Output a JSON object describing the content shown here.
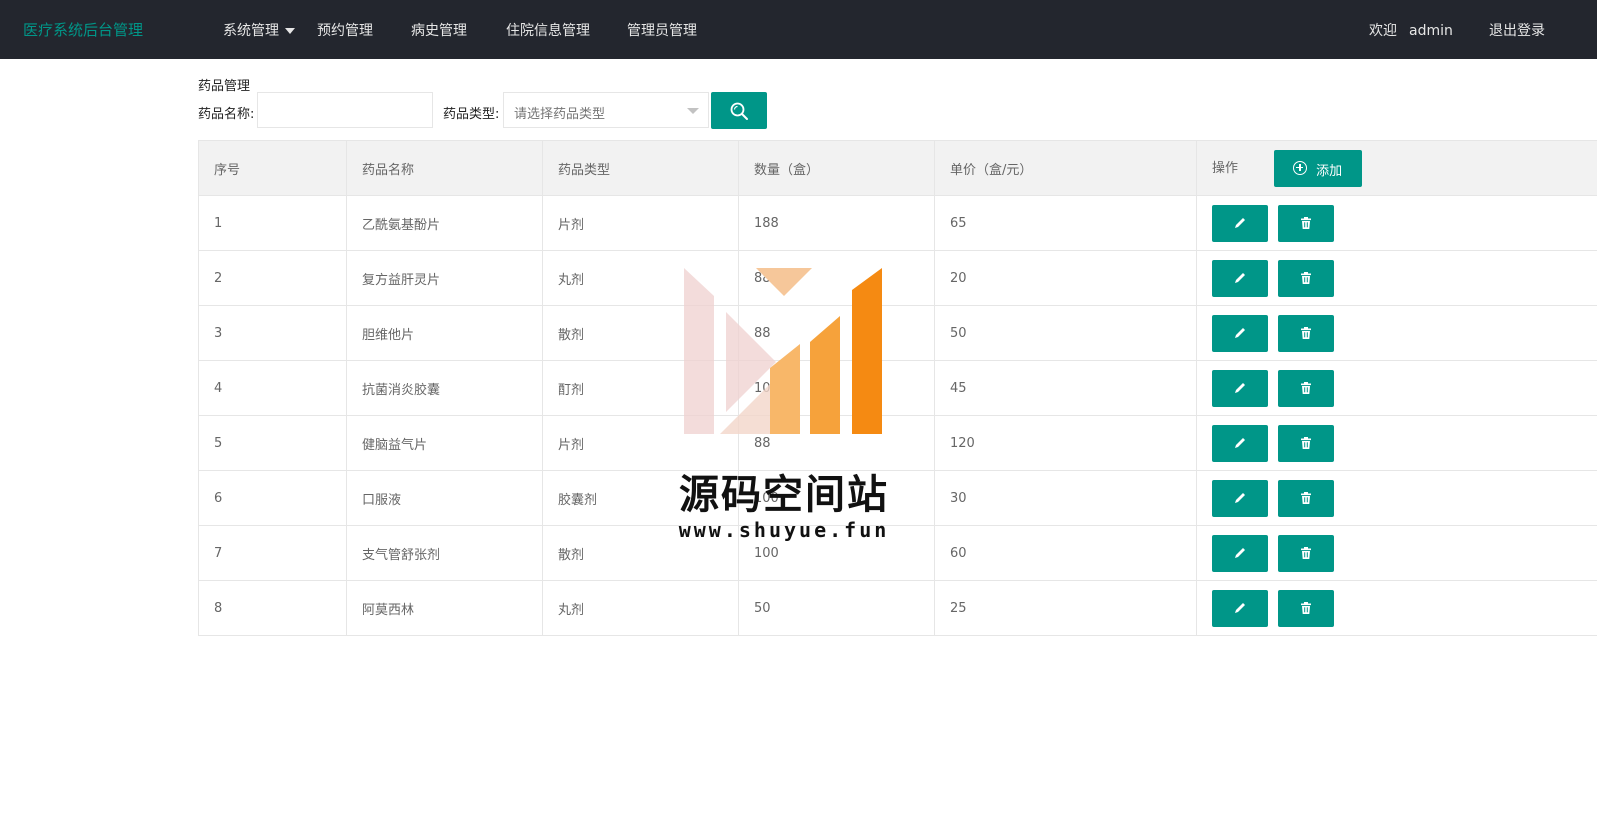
{
  "header": {
    "brand": "医疗系统后台管理",
    "nav": [
      {
        "label": "系统管理"
      },
      {
        "label": "预约管理"
      },
      {
        "label": "病史管理"
      },
      {
        "label": "住院信息管理"
      },
      {
        "label": "管理员管理"
      }
    ],
    "welcome_label": "欢迎",
    "username": "admin",
    "logout_label": "退出登录"
  },
  "search": {
    "section_title": "药品管理",
    "name_label": "药品名称:",
    "name_value": "",
    "type_label": "药品类型:",
    "type_placeholder": "请选择药品类型"
  },
  "table": {
    "headers": [
      "序号",
      "药品名称",
      "药品类型",
      "数量（盒）",
      "单价（盒/元）",
      "操作"
    ],
    "add_label": "添加",
    "rows": [
      {
        "id": "1",
        "name": "乙酰氨基酚片",
        "type": "片剂",
        "qty": "188",
        "price": "65"
      },
      {
        "id": "2",
        "name": "复方益肝灵片",
        "type": "丸剂",
        "qty": "88",
        "price": "20"
      },
      {
        "id": "3",
        "name": "胆维他片",
        "type": "散剂",
        "qty": "88",
        "price": "50"
      },
      {
        "id": "4",
        "name": "抗菌消炎胶囊",
        "type": "酊剂",
        "qty": "100",
        "price": "45"
      },
      {
        "id": "5",
        "name": "健脑益气片",
        "type": "片剂",
        "qty": "88",
        "price": "120"
      },
      {
        "id": "6",
        "name": "口服液",
        "type": "胶囊剂",
        "qty": "100",
        "price": "30"
      },
      {
        "id": "7",
        "name": "支气管舒张剂",
        "type": "散剂",
        "qty": "100",
        "price": "60"
      },
      {
        "id": "8",
        "name": "阿莫西林",
        "type": "丸剂",
        "qty": "50",
        "price": "25"
      }
    ]
  },
  "watermark": {
    "title": "源码空间站",
    "url": "www.shuyue.fun"
  },
  "colors": {
    "accent": "#009688",
    "topbar": "#23262e",
    "header_row": "#f2f2f2"
  }
}
